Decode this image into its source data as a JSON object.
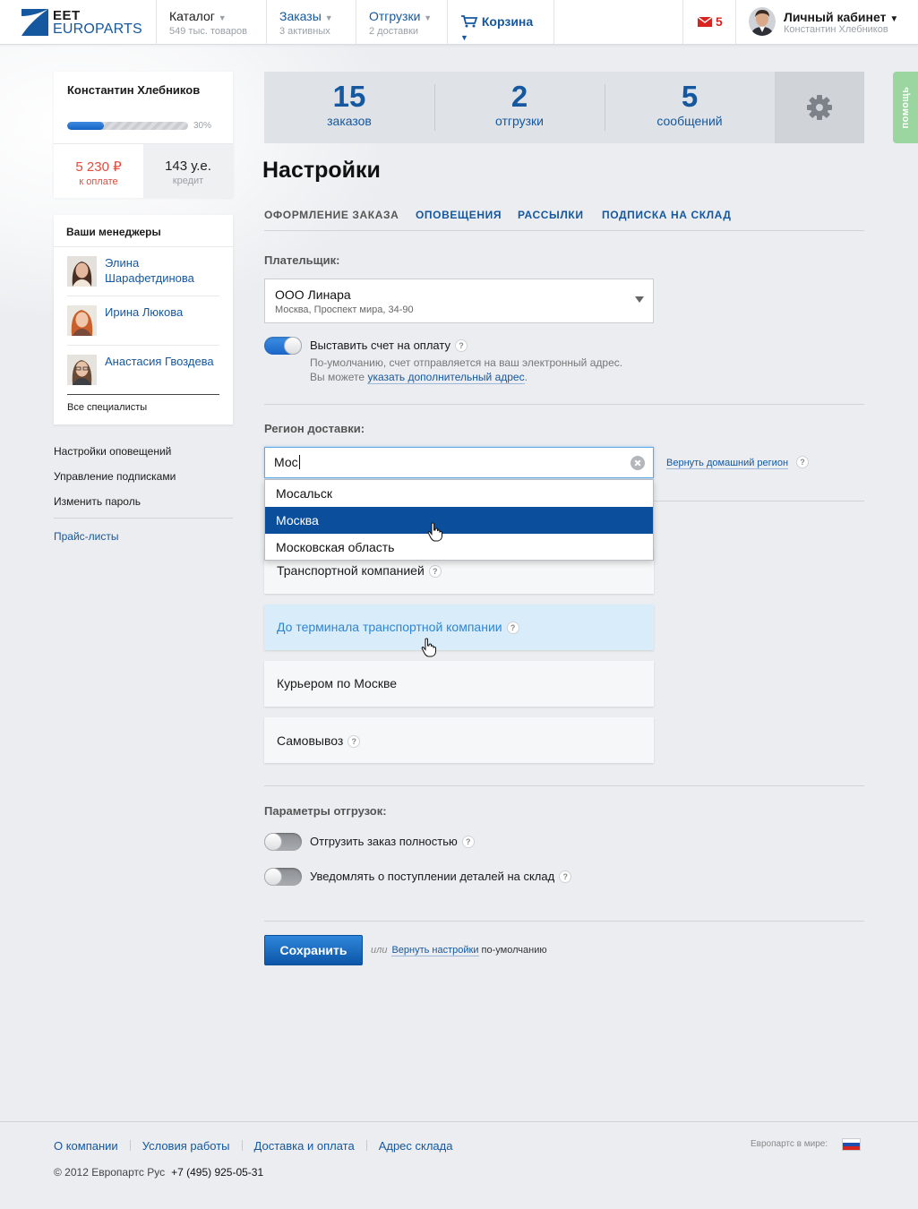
{
  "header": {
    "logo_top": "EET",
    "logo_bottom": "EUROPARTS",
    "catalog": {
      "label": "Каталог",
      "sub": "549 тыс. товаров"
    },
    "orders": {
      "label": "Заказы",
      "sub": "3 активных"
    },
    "shipments": {
      "label": "Отгрузки",
      "sub": "2 доставки"
    },
    "cart": {
      "label": "Корзина"
    },
    "mail_count": "5",
    "cabinet": {
      "label": "Личный кабинет",
      "sub": "Константин Хлебников"
    }
  },
  "help_tab": "помощь",
  "sidebar": {
    "user": {
      "name": "Константин Хлебников",
      "progress_percent": 30,
      "progress_label": "30%",
      "to_pay_value": "5 230 ₽",
      "to_pay_label": "к оплате",
      "credit_value": "143 у.е.",
      "credit_label": "кредит"
    },
    "managers": {
      "title": "Ваши менеджеры",
      "items": [
        {
          "name": "Элина Шарафетдинова"
        },
        {
          "name": "Ирина Люкова"
        },
        {
          "name": "Анастасия Гвоздева"
        }
      ],
      "all_link": "Все специалисты"
    },
    "links": [
      "Настройки оповещений",
      "Управление подписками",
      "Изменить пароль"
    ],
    "price_lists": "Прайс-листы"
  },
  "stats": [
    {
      "value": "15",
      "label": "заказов"
    },
    {
      "value": "2",
      "label": "отгрузки"
    },
    {
      "value": "5",
      "label": "сообщений"
    }
  ],
  "page": {
    "title": "Настройки",
    "tabs": [
      "Оформление заказа",
      "Оповещения",
      "Рассылки",
      "Подписка на склад"
    ],
    "active_tab": 0
  },
  "payer": {
    "label": "Плательщик:",
    "value": "ООО Линара",
    "address": "Москва, Проспект мира, 34-90"
  },
  "invoice_toggle": {
    "label": "Выставить счет на оплату",
    "enabled": true,
    "hint_line1": "По-умолчанию, счет отправляется на ваш электронный адрес.",
    "hint_line2_prefix": "Вы можете ",
    "hint_link": "указать дополнительный адрес",
    "hint_line2_suffix": "."
  },
  "region": {
    "label": "Регион доставки:",
    "input_value": "Мос",
    "reset_link": "Вернуть домашний регион",
    "suggestions": [
      "Мосальск",
      "Москва",
      "Московская область"
    ],
    "selected_suggestion": 1
  },
  "delivery_options": [
    {
      "label": "Транспортной компанией",
      "help": true
    },
    {
      "label": "До терминала транспортной компании",
      "help": true
    },
    {
      "label": "Курьером по Москве",
      "help": false
    },
    {
      "label": "Самовывоз",
      "help": true
    }
  ],
  "shipment_params": {
    "label": "Параметры отгрузок:",
    "options": [
      {
        "label": "Отгрузить заказ полностью",
        "enabled": false
      },
      {
        "label": "Уведомлять о поступлении деталей на склад",
        "enabled": false
      }
    ]
  },
  "actions": {
    "save": "Сохранить",
    "or": "или",
    "reset_link": "Вернуть настройки",
    "reset_suffix": " по-умолчанию"
  },
  "footer": {
    "links": [
      "О компании",
      "Условия работы",
      "Доставка и оплата",
      "Адрес склада"
    ],
    "copyright": "© 2012 Европартс Рус",
    "phone": "+7 (495) 925-05-31",
    "world_label": "Европартс в мире:"
  },
  "colors": {
    "brand_blue": "#1558a0",
    "accent_red": "#e24a3b",
    "help_green": "#9bd6a0",
    "selected_item": "#0b4f9c"
  },
  "icons": [
    "envelope-icon",
    "cart-icon",
    "gear-icon",
    "help-icon",
    "clear-icon",
    "hand-cursor-icon",
    "russia-flag-icon"
  ]
}
